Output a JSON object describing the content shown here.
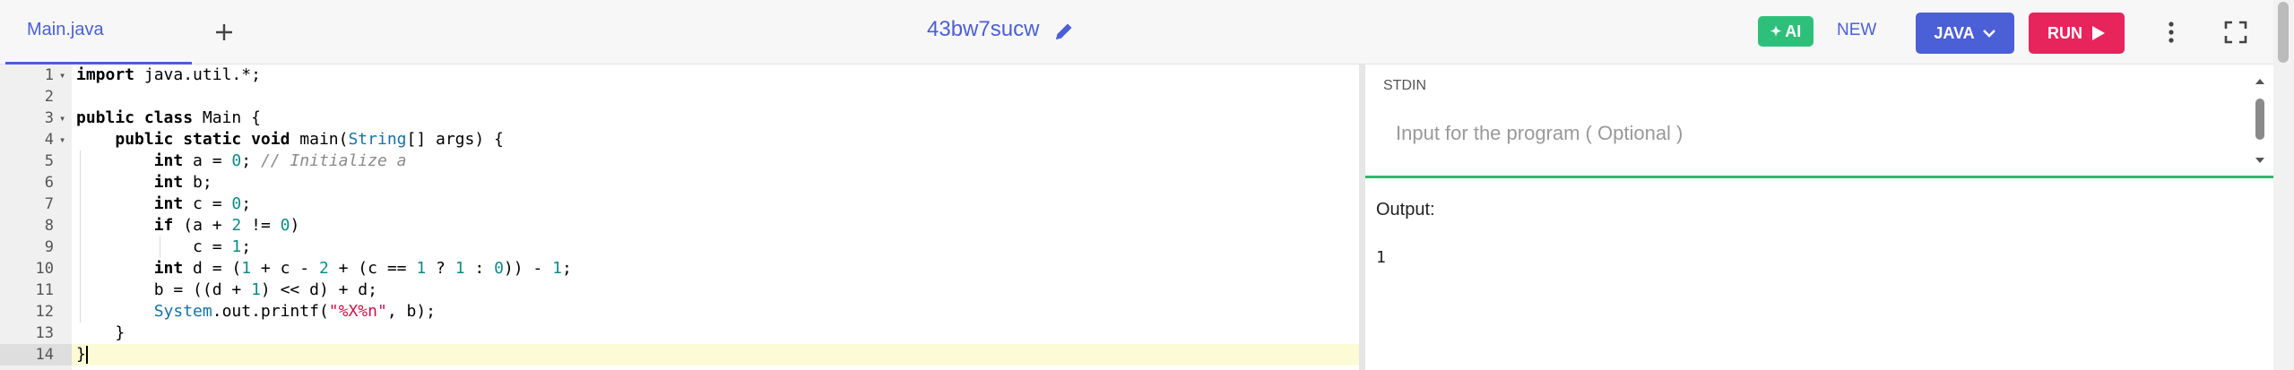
{
  "header": {
    "file_tab_label": "Main.java",
    "project_name": "43bw7sucw",
    "ai_label": "AI",
    "new_label": "NEW",
    "language_label": "JAVA",
    "run_label": "RUN"
  },
  "editor": {
    "line_numbers": [
      "1",
      "2",
      "3",
      "4",
      "5",
      "6",
      "7",
      "8",
      "9",
      "10",
      "11",
      "12",
      "13",
      "14"
    ],
    "code_lines": [
      "import java.util.*;",
      "",
      "public class Main {",
      "    public static void main(String[] args) {",
      "        int a = 0; // Initialize a",
      "        int b;",
      "        int c = 0;",
      "        if (a + 2 != 0)",
      "            c = 1;",
      "        int d = (1 + c - 2 + (c == 1 ? 1 : 0)) - 1;",
      "        b = ((d + 1) << d) + d;",
      "        System.out.printf(\"%X%n\", b);",
      "    }",
      "}"
    ],
    "active_line": 14
  },
  "stdin": {
    "label": "STDIN",
    "placeholder": "Input for the program ( Optional )",
    "value": ""
  },
  "output": {
    "label": "Output:",
    "text": "1"
  },
  "colors": {
    "accent": "#4b5fd6",
    "ai_green": "#2ec07a",
    "run_red": "#e8245d",
    "divider_green": "#30b76c",
    "active_line_bg": "#fdfbd6"
  }
}
